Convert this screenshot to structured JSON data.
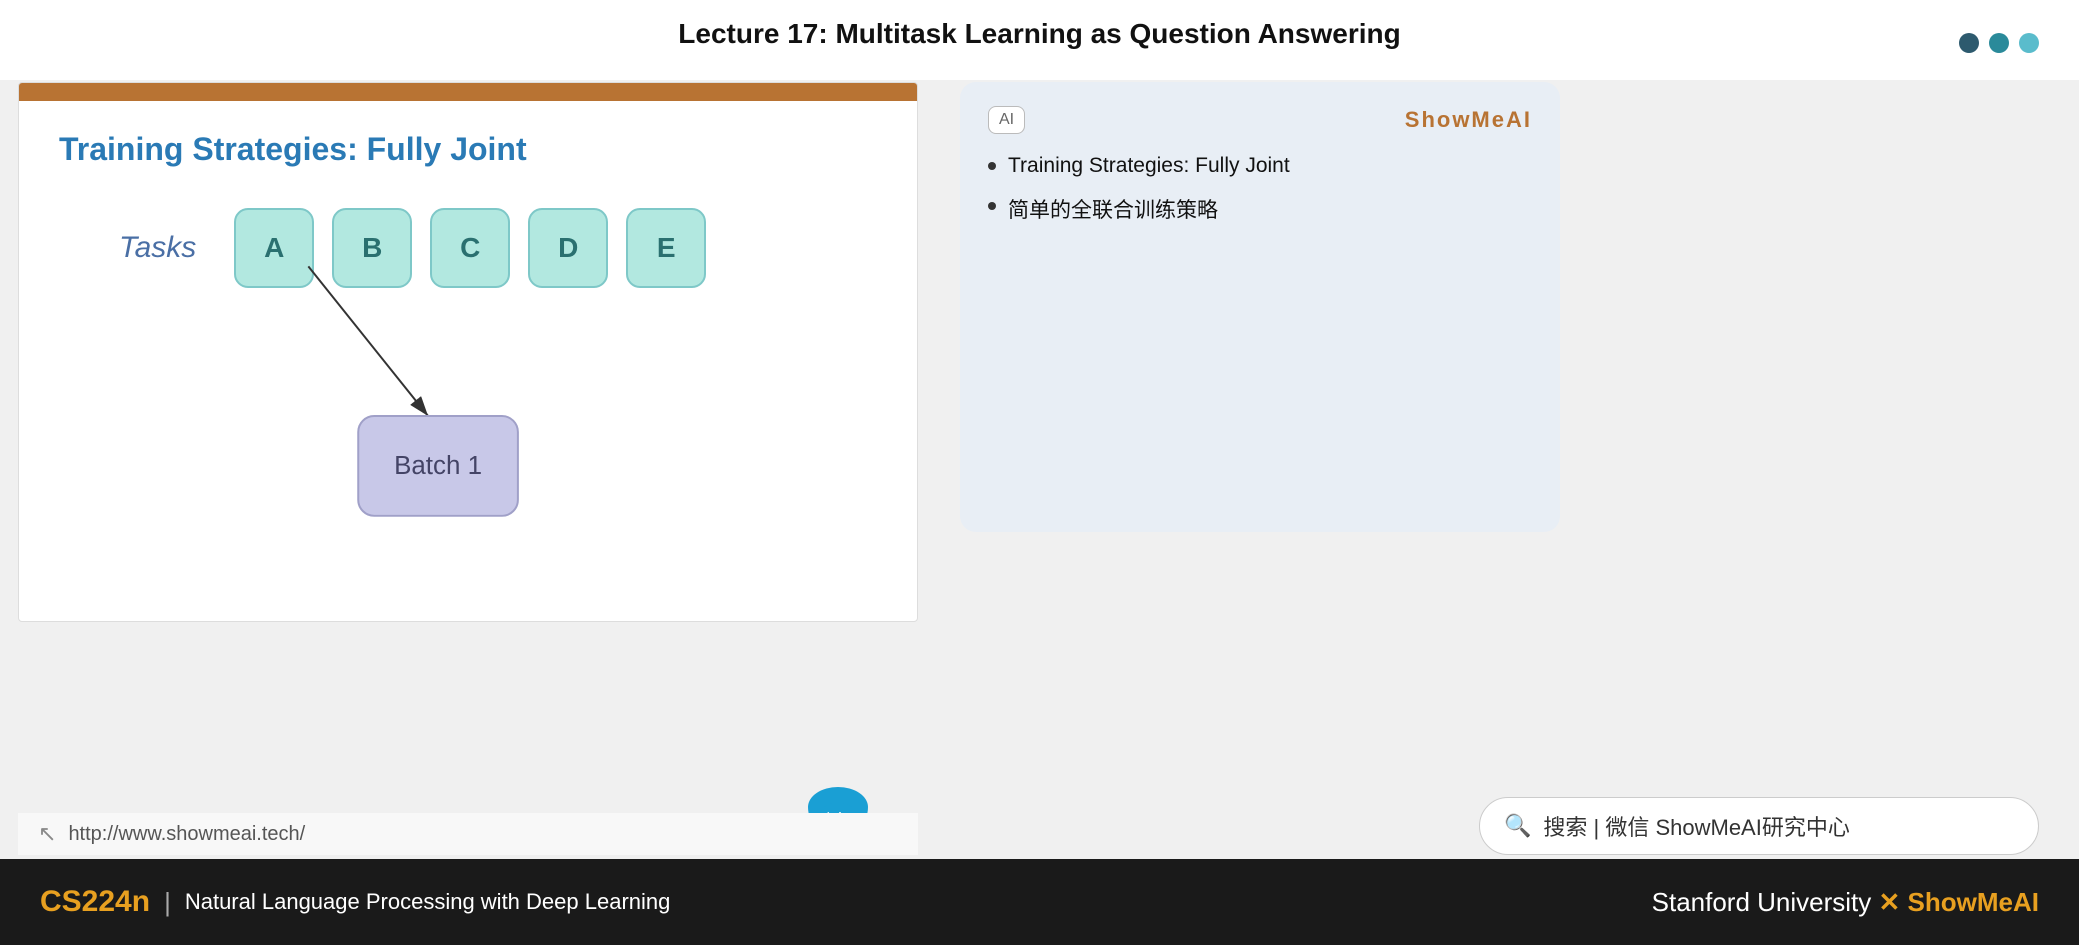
{
  "header": {
    "lecture_title": "Lecture 17: Multitask Learning as Question Answering",
    "dots": [
      "dark",
      "teal",
      "light"
    ]
  },
  "slide": {
    "title": "Training Strategies: Fully Joint",
    "tasks_label": "Tasks",
    "task_boxes": [
      "A",
      "B",
      "C",
      "D",
      "E"
    ],
    "batch_label": "Batch 1",
    "top_bar_color": "#b87333",
    "url": "http://www.showmeai.tech/"
  },
  "showmeai_card": {
    "ai_badge": "AI",
    "brand": "ShowMeAI",
    "bullets": [
      "Training Strategies: Fully Joint",
      "简单的全联合训练策略"
    ]
  },
  "search": {
    "text": "搜索 | 微信 ShowMeAI研究中心"
  },
  "footer": {
    "course": "CS224n",
    "separator": "|",
    "description": "Natural Language Processing with Deep Learning",
    "right_text_1": "Stanford University",
    "x_symbol": "✕",
    "right_text_2": "ShowMeAI"
  }
}
